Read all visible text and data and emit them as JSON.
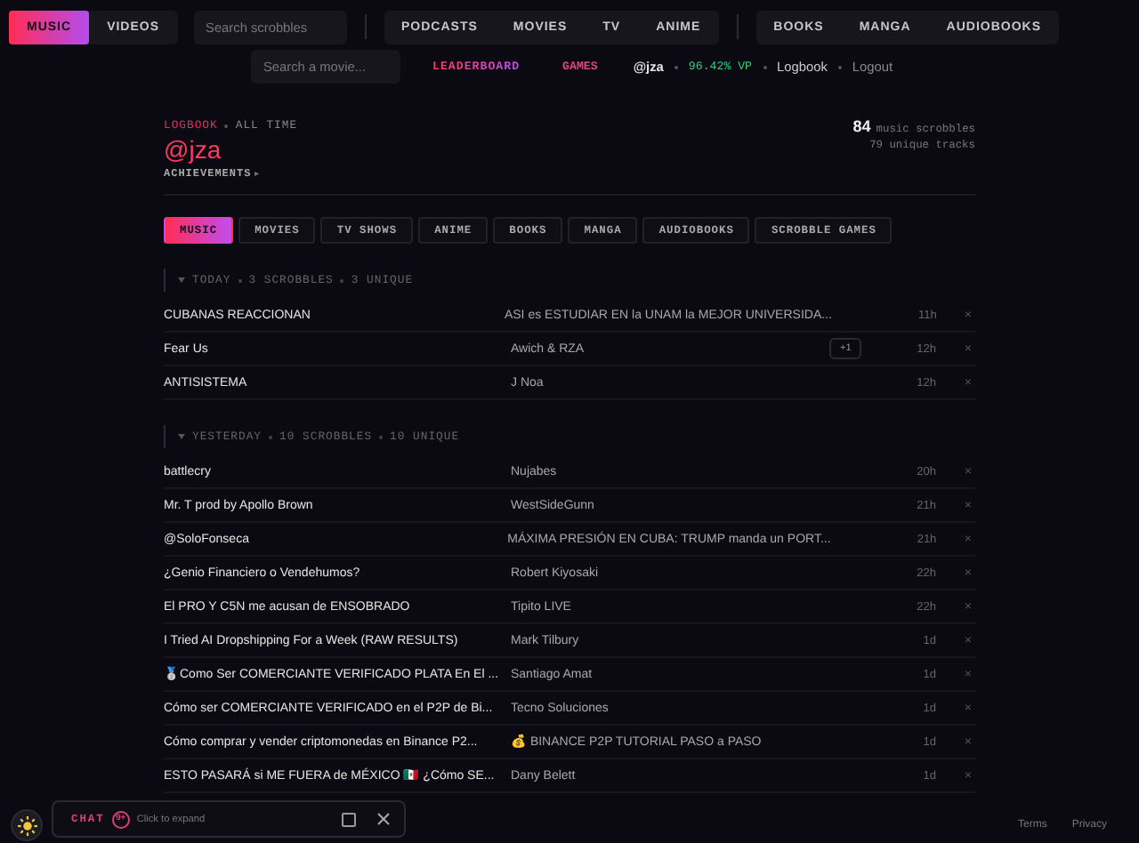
{
  "nav": {
    "groups": [
      [
        {
          "label": "MUSIC",
          "selected": true
        },
        {
          "label": "VIDEOS",
          "selected": false
        }
      ],
      [
        {
          "label": "PODCASTS",
          "selected": false
        },
        {
          "label": "MOVIES",
          "selected": false
        },
        {
          "label": "TV",
          "selected": false
        },
        {
          "label": "ANIME",
          "selected": false
        }
      ],
      [
        {
          "label": "BOOKS",
          "selected": false
        },
        {
          "label": "MANGA",
          "selected": false
        },
        {
          "label": "AUDIOBOOKS",
          "selected": false
        }
      ]
    ],
    "search": {
      "placeholder": "Search scrobbles"
    }
  },
  "subnav": {
    "search": {
      "placeholder": "Search a movie..."
    },
    "leaderboard": "LEADERBOARD",
    "games": "GAMES",
    "user": "@jza",
    "vp": "96.42% VP",
    "logbook": "Logbook",
    "logout": "Logout"
  },
  "header": {
    "crumb": "LOGBOOK",
    "range": "ALL TIME",
    "username": "@jza",
    "achievements": "ACHIEVEMENTS",
    "achievements_arrow": "▸",
    "scrobble_count": "84",
    "scrobble_label": "music scrobbles",
    "unique": "79 unique tracks"
  },
  "tabs": [
    {
      "label": "MUSIC",
      "selected": true
    },
    {
      "label": "MOVIES",
      "selected": false
    },
    {
      "label": "TV SHOWS",
      "selected": false
    },
    {
      "label": "ANIME",
      "selected": false
    },
    {
      "label": "BOOKS",
      "selected": false
    },
    {
      "label": "MANGA",
      "selected": false
    },
    {
      "label": "AUDIOBOOKS",
      "selected": false
    },
    {
      "label": "SCROBBLE GAMES",
      "selected": false
    }
  ],
  "groups": [
    {
      "label": "TODAY",
      "scrobbles": "3 SCROBBLES",
      "unique": "3 UNIQUE",
      "expanded": true,
      "rows": [
        {
          "title": "CUBANAS REACCIONAN",
          "artist": "ASI es ESTUDIAR EN la UNAM la MEJOR UNIVERSIDA...",
          "time": "11h",
          "remove": "×"
        },
        {
          "title": "Fear Us",
          "artist": "Awich & RZA",
          "badge": "+1",
          "time": "12h",
          "remove": "×"
        },
        {
          "title": "ANTISISTEMA",
          "artist": "J Noa",
          "time": "12h",
          "remove": "×"
        }
      ]
    },
    {
      "label": "YESTERDAY",
      "scrobbles": "10 SCROBBLES",
      "unique": "10 UNIQUE",
      "expanded": true,
      "rows": [
        {
          "title": "battlecry",
          "artist": "Nujabes",
          "time": "20h",
          "remove": "×"
        },
        {
          "title": "Mr. T prod by Apollo Brown",
          "artist": "WestSideGunn",
          "time": "21h",
          "remove": "×"
        },
        {
          "title": "@SoloFonseca",
          "artist": "MÁXIMA PRESIÓN EN CUBA: TRUMP manda un PORT...",
          "time": "21h",
          "remove": "×"
        },
        {
          "title": "¿Genio Financiero o Vendehumos?",
          "artist": "Robert Kiyosaki",
          "time": "22h",
          "remove": "×"
        },
        {
          "title": "El PRO Y C5N me acusan de ENSOBRADO",
          "artist": "Tipito LIVE",
          "time": "22h",
          "remove": "×"
        },
        {
          "title": "I Tried AI Dropshipping For a Week (RAW RESULTS)",
          "artist": "Mark Tilbury",
          "time": "1d",
          "remove": "×"
        },
        {
          "title": "🥈Como Ser COMERCIANTE VERIFICADO PLATA En El ...",
          "artist": "Santiago Amat",
          "time": "1d",
          "remove": "×"
        },
        {
          "title": "Cómo ser COMERCIANTE VERIFICADO en el P2P de Bi...",
          "artist": "Tecno Soluciones",
          "time": "1d",
          "remove": "×"
        },
        {
          "title": "Cómo comprar y vender criptomonedas en Binance P2...",
          "artist": "💰 BINANCE P2P TUTORIAL PASO a PASO",
          "time": "1d",
          "remove": "×"
        },
        {
          "title": "ESTO PASARÁ si ME FUERA de MÉXICO 🇲🇽 ¿Cómo SE...",
          "artist": "Dany Belett",
          "time": "1d",
          "remove": "×"
        }
      ]
    }
  ],
  "chat": {
    "label": "CHAT",
    "count": "9+",
    "hint": "Click to expand"
  },
  "footer": {
    "links": [
      "Terms",
      "Privacy"
    ]
  }
}
